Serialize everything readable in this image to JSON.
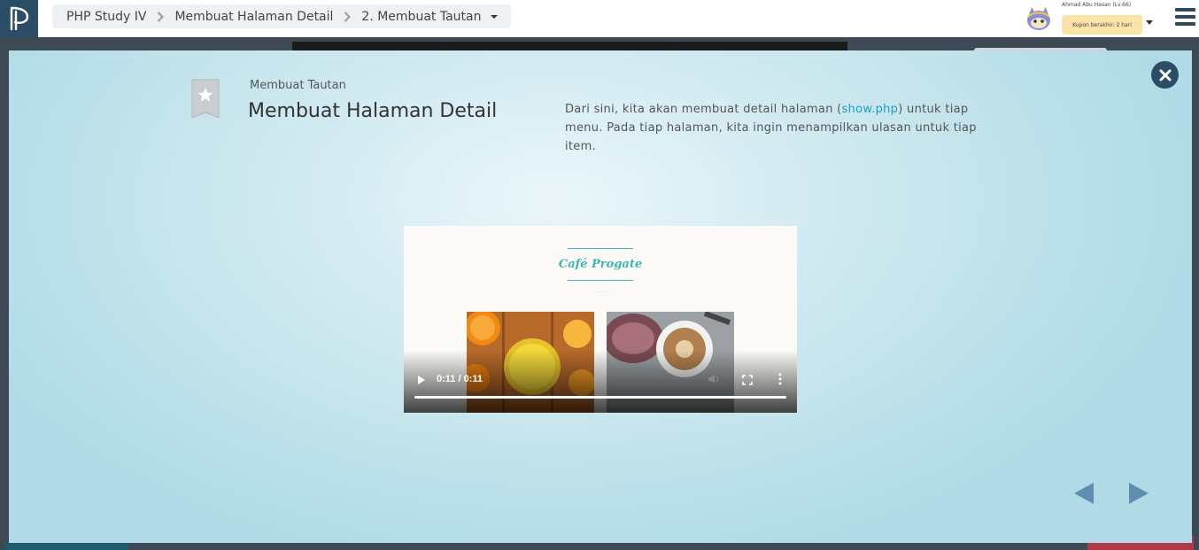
{
  "breadcrumb": {
    "items": [
      "PHP Study IV",
      "Membuat Halaman Detail",
      "2. Membuat Tautan"
    ]
  },
  "user": {
    "name": "Ahmad Abu Hasan (Lv.66)",
    "coupon": "Kupon berakhir: 2 hari"
  },
  "slide": {
    "subtitle": "Membuat Tautan",
    "title": "Membuat Halaman Detail",
    "desc_before": "Dari sini, kita akan membuat detail halaman (",
    "desc_code": "show.php",
    "desc_after": ") untuk tiap menu. Pada tiap halaman, kita ingin menampilkan ulasan untuk tiap item."
  },
  "video": {
    "site_title": "Café Progate",
    "time": "0:11 / 0:11",
    "progress": 1.0
  },
  "icons": {
    "logo": "progate-logo-icon",
    "close": "close-icon",
    "bookmark": "bookmark-star-icon",
    "prev": "triangle-left-icon",
    "next": "triangle-right-icon",
    "menu": "hamburger-menu-icon"
  },
  "colors": {
    "navy": "#2b4e66",
    "accent_link": "#1aa0c8",
    "cafe_teal": "#3bb7b0",
    "coupon_bg": "#fbe3a7"
  }
}
